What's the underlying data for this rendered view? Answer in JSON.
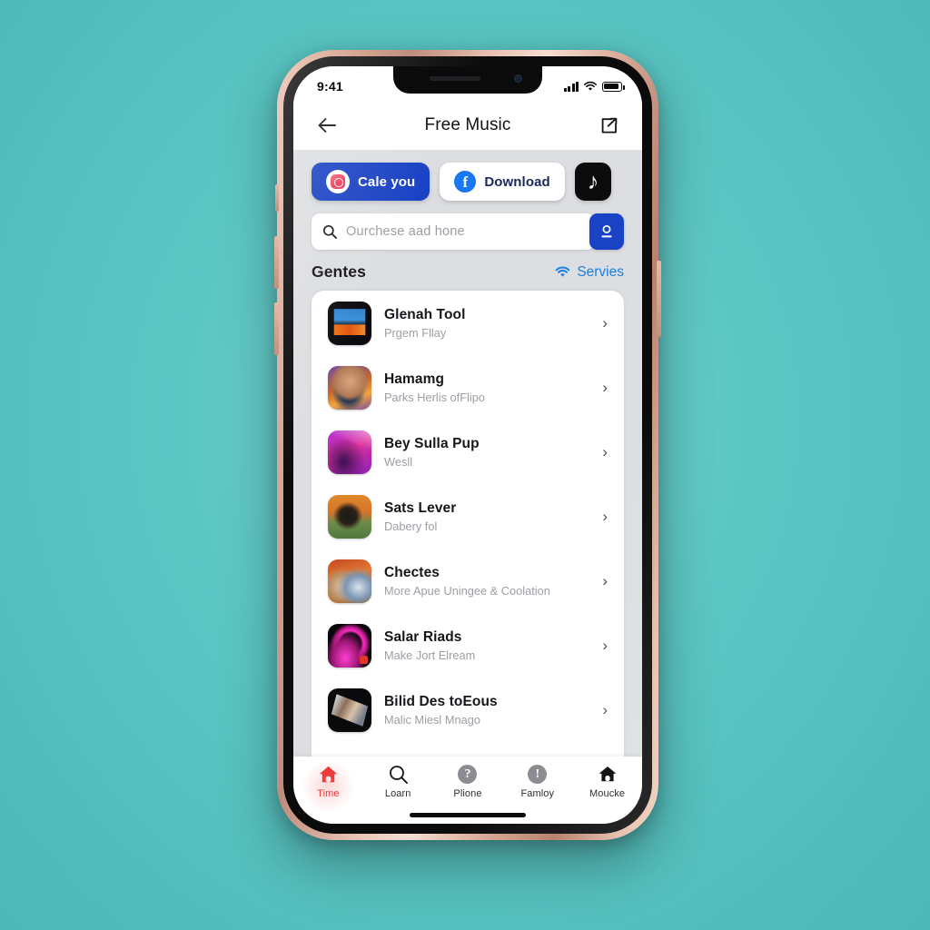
{
  "background_color": "#5bc6c3",
  "device": {
    "frame_color": "#d8a995",
    "bezel_color": "#0b0b0c"
  },
  "status_bar": {
    "time": "9:41",
    "signal_icon": "signal-bars-icon",
    "wifi_icon": "wifi-icon",
    "battery_icon": "battery-icon"
  },
  "navbar": {
    "back_icon": "back-arrow-icon",
    "title": "Free Music",
    "share_icon": "share-icon"
  },
  "chips": [
    {
      "label": "Cale you",
      "icon": "instagram-icon",
      "style": "blue"
    },
    {
      "label": "Download",
      "icon": "facebook-icon",
      "style": "white"
    },
    {
      "label": "",
      "icon": "tiktok-icon",
      "style": "black"
    }
  ],
  "search": {
    "placeholder": "Ourchese aad hone",
    "value": "",
    "search_icon": "search-icon",
    "action_icon": "account-icon",
    "action_color": "#1a42c4"
  },
  "section": {
    "title": "Gentes",
    "link_label": "Servies",
    "link_icon": "wifi-icon",
    "link_color": "#1b7fe0"
  },
  "list": [
    {
      "title": "Glenah Tool",
      "subtitle": "Prgem Fllay",
      "thumb": "city-night-art",
      "chevron": "chevron-right-icon"
    },
    {
      "title": "Hamamg",
      "subtitle": "Parks Herlis ofFlipo",
      "thumb": "portrait-sunset",
      "chevron": "chevron-right-icon"
    },
    {
      "title": "Bey Sulla Pup",
      "subtitle": "Wesll",
      "thumb": "dancer-magenta",
      "chevron": "chevron-right-icon"
    },
    {
      "title": "Sats Lever",
      "subtitle": "Dabery fol",
      "thumb": "silhouette-field",
      "chevron": "chevron-right-icon"
    },
    {
      "title": "Chectes",
      "subtitle": "More Apue Uningee & Coolation",
      "thumb": "family-autumn",
      "chevron": "chevron-right-icon"
    },
    {
      "title": "Salar Riads",
      "subtitle": "Make Jort Elream",
      "thumb": "neon-pink-dark",
      "chevron": "chevron-right-icon"
    },
    {
      "title": "Bilid Des toEous",
      "subtitle": "Malic Miesl Mnago",
      "thumb": "collage-dark",
      "chevron": "chevron-right-icon"
    }
  ],
  "tabs": [
    {
      "label": "Time",
      "icon": "home-icon",
      "active": true
    },
    {
      "label": "Loarn",
      "icon": "search-icon",
      "active": false
    },
    {
      "label": "Plione",
      "icon": "question-circle-icon",
      "active": false
    },
    {
      "label": "Famloy",
      "icon": "info-circle-icon",
      "active": false
    },
    {
      "label": "Moucke",
      "icon": "house-icon",
      "active": false
    }
  ],
  "active_tab_color": "#ef3b3b"
}
